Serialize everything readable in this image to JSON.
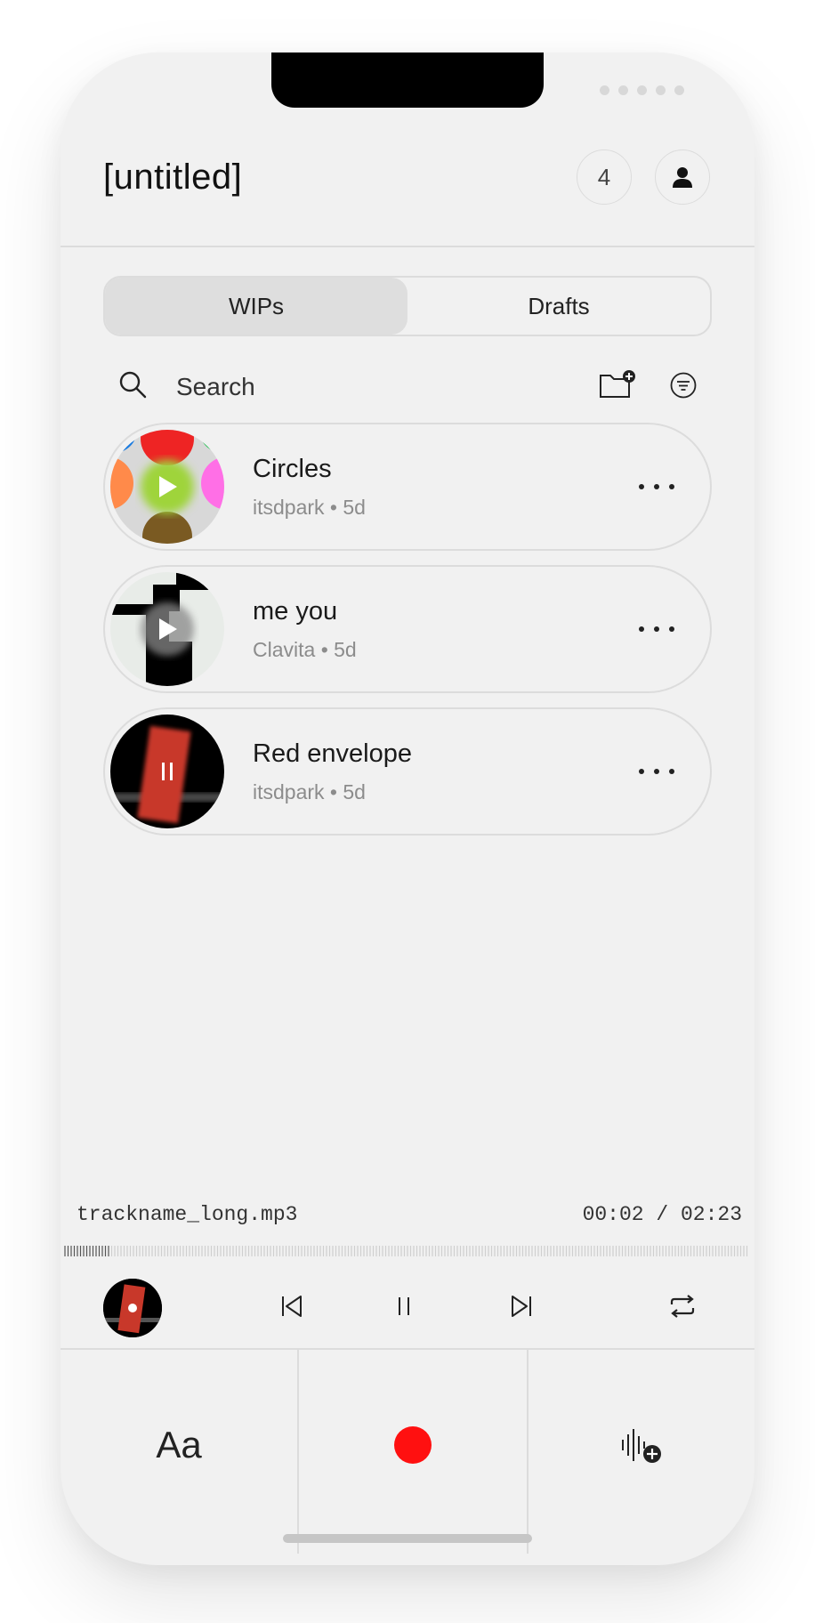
{
  "header": {
    "title": "[untitled]",
    "count": "4"
  },
  "tabs": [
    {
      "label": "WIPs",
      "active": true
    },
    {
      "label": "Drafts",
      "active": false
    }
  ],
  "search": {
    "placeholder": "Search"
  },
  "tracks": [
    {
      "title": "Circles",
      "subtitle": "itsdpark • 5d",
      "state": "play"
    },
    {
      "title": "me you",
      "subtitle": "Clavita • 5d",
      "state": "play"
    },
    {
      "title": "Red envelope",
      "subtitle": "itsdpark • 5d",
      "state": "pause"
    }
  ],
  "now_playing": {
    "filename": "trackname_long.mp3",
    "time": "00:02 / 02:23",
    "progress": 0.015
  },
  "compose": {
    "text_label": "Aa"
  },
  "colors": {
    "background": "#f1f1f1",
    "border": "#dcdcdc",
    "record": "#ff1010",
    "subtle_text": "#8c8c8c"
  }
}
